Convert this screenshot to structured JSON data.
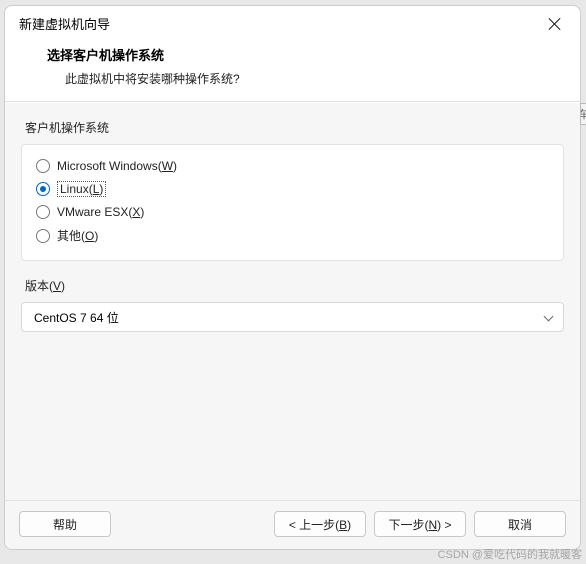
{
  "window": {
    "title": "新建虚拟机向导"
  },
  "header": {
    "title": "选择客户机操作系统",
    "subtitle": "此虚拟机中将安装哪种操作系统?"
  },
  "os_group": {
    "label": "客户机操作系统",
    "options": [
      {
        "text": "Microsoft Windows(",
        "hotkey": "W",
        "tail": ")",
        "selected": false
      },
      {
        "text": "Linux(",
        "hotkey": "L",
        "tail": ")",
        "selected": true
      },
      {
        "text": "VMware ESX(",
        "hotkey": "X",
        "tail": ")",
        "selected": false
      },
      {
        "text": "其他(",
        "hotkey": "O",
        "tail": ")",
        "selected": false
      }
    ]
  },
  "version": {
    "label_pre": "版本(",
    "label_hotkey": "V",
    "label_post": ")",
    "selected": "CentOS 7 64 位"
  },
  "buttons": {
    "help": "帮助",
    "back_pre": "< 上一步(",
    "back_hot": "B",
    "back_post": ")",
    "next_pre": "下一步(",
    "next_hot": "N",
    "next_post": ") >",
    "cancel": "取消"
  },
  "side_hint": "车",
  "watermark": "CSDN @爱吃代码的我就暖客"
}
